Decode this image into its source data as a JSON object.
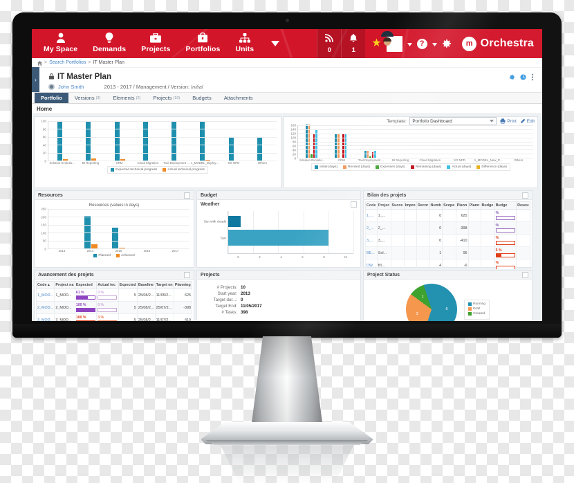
{
  "app": {
    "brand_name": "Orchestra",
    "brand_mark": "m",
    "nav": [
      {
        "label": "My Space",
        "icon": "user-icon"
      },
      {
        "label": "Demands",
        "icon": "lightbulb-icon"
      },
      {
        "label": "Projects",
        "icon": "briefcase-icon"
      },
      {
        "label": "Portfolios",
        "icon": "portfolio-icon"
      },
      {
        "label": "Units",
        "icon": "org-chart-icon"
      }
    ],
    "nav_caret": "caret-down-icon",
    "feed": {
      "icon": "rss-icon",
      "count": "0"
    },
    "alerts": {
      "icon": "bell-icon",
      "count": "1"
    },
    "star": "★",
    "help": "?",
    "settings_icon": "gear-icon"
  },
  "breadcrumb": {
    "home_icon": "home-icon",
    "sep": ">",
    "items": [
      "Search Portfolios",
      "IT Master Plan"
    ]
  },
  "header": {
    "side_toggle": "›",
    "lock_icon": "lock-icon",
    "title": "IT Master Plan",
    "user": "John Smith",
    "meta": "2013 - 2017 / Management / Version:",
    "meta_version": "Initial",
    "tools": [
      "gear-icon",
      "history-icon",
      "more-vert-icon"
    ]
  },
  "tabs": [
    {
      "label": "Portfolio",
      "count": "",
      "active": true
    },
    {
      "label": "Versions",
      "count": "(3)",
      "active": false
    },
    {
      "label": "Elements",
      "count": "(2)",
      "active": false
    },
    {
      "label": "Projects",
      "count": "(10)",
      "active": false
    },
    {
      "label": "Budgets",
      "count": "",
      "active": false
    },
    {
      "label": "Attachments",
      "count": "",
      "active": false
    }
  ],
  "subtitle": "Home",
  "template_bar": {
    "label": "Template:",
    "selected": "Portfolio Dashboard",
    "caret": "caret-down-icon",
    "print": "Print",
    "edit": "Edit"
  },
  "panels": {
    "progress_title": "",
    "resources_title": "Resources",
    "budget_title": "Budget",
    "weather_title": "Weather",
    "bilan_title": "Bilan des projets",
    "status_title": "Project Status",
    "avancement_title": "Avancement des projets",
    "projects_title": "Projects"
  },
  "colors": {
    "brand_red": "#d3152a",
    "teal": "#1f8fae",
    "orange": "#f08a24",
    "green": "#3aa02a",
    "dark_red": "#c00d18",
    "light_blue": "#3cc0e8",
    "yellow": "#e8b019",
    "nav_blue": "#3c5a78",
    "link": "#4a86c8"
  },
  "chart_data": [
    {
      "type": "bar",
      "id": "technical-progress",
      "title": "",
      "categories": [
        "Solution Evolutio...",
        "BI Reporting",
        "CRM",
        "Cloud Migration",
        "Tool Deployment ...",
        "1_MODEL_Deploymen...",
        "SG NPD",
        "Others"
      ],
      "series": [
        {
          "name": "Expected technical progress",
          "color": "#1f8fae",
          "values": [
            100,
            100,
            100,
            100,
            100,
            100,
            60,
            59
          ]
        },
        {
          "name": "Actual technical progress",
          "color": "#f08a24",
          "values": [
            4,
            6,
            4,
            0,
            0,
            2,
            0,
            0
          ]
        }
      ],
      "yticks": [
        "100",
        "80",
        "60",
        "40",
        "20",
        "0"
      ],
      "ylim": [
        0,
        100
      ],
      "legend_position": "bottom",
      "grid": true
    },
    {
      "type": "bar",
      "id": "portfolio-days",
      "title": "",
      "categories": [
        "Solution Evolutio...",
        "CRM",
        "Tool Deployment ...",
        "BI Reporting",
        "Cloud Migration",
        "SG NPD",
        "1_MODEL_New_Produ...",
        "Others"
      ],
      "series": [
        {
          "name": "Initial (days)",
          "color": "#1f8fae",
          "values": [
            165,
            120,
            35,
            0,
            0,
            0,
            0,
            0
          ]
        },
        {
          "name": "Revised (days)",
          "color": "#f0995a",
          "values": [
            165,
            120,
            35,
            0,
            0,
            0,
            0,
            0
          ]
        },
        {
          "name": "Expenses (days)",
          "color": "#3aa02a",
          "values": [
            22,
            0,
            6,
            0,
            0,
            0,
            0,
            0
          ]
        },
        {
          "name": "Remaining (days)",
          "color": "#c00d18",
          "values": [
            115,
            120,
            26,
            0,
            0,
            0,
            0,
            0
          ]
        },
        {
          "name": "Actual (days)",
          "color": "#3cc0e8",
          "values": [
            140,
            120,
            35,
            0,
            0,
            0,
            0,
            0
          ]
        },
        {
          "name": "Difference (days)",
          "color": "#e8b019",
          "values": [
            0,
            0,
            0,
            0,
            0,
            0,
            0,
            0
          ]
        }
      ],
      "yticks": [
        "160",
        "140",
        "120",
        "100",
        "80",
        "60",
        "40",
        "20",
        "0"
      ],
      "ylim": [
        0,
        160
      ],
      "legend_position": "bottom",
      "grid": true
    },
    {
      "type": "bar",
      "id": "resources",
      "title": "Resources (values in days)",
      "categories": [
        "2013",
        "2014",
        "2015",
        "2016",
        "2017"
      ],
      "series": [
        {
          "name": "Planned",
          "color": "#1f8fae",
          "values": [
            0,
            205,
            130,
            0,
            0
          ]
        },
        {
          "name": "Achieved",
          "color": "#f08a24",
          "values": [
            0,
            28,
            3,
            0,
            0
          ]
        }
      ],
      "yticks": [
        "250",
        "200",
        "150",
        "100",
        "50",
        "0"
      ],
      "ylim": [
        0,
        250
      ],
      "legend_position": "bottom",
      "grid": true
    },
    {
      "type": "bar",
      "id": "weather",
      "orientation": "horizontal",
      "title": "",
      "categories": [
        "Sun with clouds",
        "Sun"
      ],
      "series": [
        {
          "name": "Weather",
          "colors": [
            "#1079a0",
            "#3aa3c4"
          ],
          "values": [
            1,
            8
          ]
        }
      ],
      "xticks": [
        "0",
        "2",
        "4",
        "6",
        "8",
        "10"
      ],
      "xlim": [
        0,
        10
      ],
      "grid": true
    },
    {
      "type": "pie",
      "id": "project-status",
      "title": "Project Status",
      "labels": [
        "Running",
        "Draft",
        "Created"
      ],
      "values": [
        6,
        3,
        1
      ],
      "display_labels": [
        "6",
        "3",
        "1"
      ],
      "colors": [
        "#1f8fae",
        "#f6954a",
        "#3aa02a"
      ],
      "legend_position": "right"
    }
  ],
  "bilan_table": {
    "columns": [
      "Code",
      "Projec",
      "Succe",
      "Impro",
      "Recor",
      "Numb",
      "Scope",
      "Plann",
      "Plann",
      "Budge",
      "Budge",
      "Resou"
    ],
    "rows": [
      {
        "code": "1_...",
        "project": "1_...",
        "numb": "0",
        "plann": "625",
        "pct": "%",
        "bar": 0,
        "bar_color": "#9a6fc0",
        "pct_color": "#7a4fb0"
      },
      {
        "code": "2_...",
        "project": "2_...",
        "numb": "0",
        "plann": "-398",
        "pct": "%",
        "bar": 0,
        "bar_color": "#9a6fc0",
        "pct_color": "#7a4fb0"
      },
      {
        "code": "3_...",
        "project": "3_...",
        "numb": "0",
        "plann": "-410",
        "pct": "%",
        "bar": 0,
        "bar_color": "#e03a14",
        "pct_color": "#e03a14"
      },
      {
        "code": "BE...",
        "project": "Sol...",
        "numb": "1",
        "plann": "95",
        "pct": "5 %",
        "bar": 30,
        "bar_color": "#e03a14",
        "pct_color": "#e03a14"
      },
      {
        "code": "DW...",
        "project": "BI...",
        "numb": "4",
        "plann": "-6",
        "pct": "%",
        "bar": 0,
        "bar_color": "#e03a14",
        "pct_color": "#e03a14"
      }
    ]
  },
  "avancement_table": {
    "columns": [
      "Code",
      "Project na",
      "Expected",
      "Actual tec",
      "Expected",
      "Baseline",
      "Target en",
      "Planning"
    ],
    "sort_icon": "sort-asc-icon",
    "rows": [
      {
        "code": "1_MOD...",
        "name": "1_MOD...",
        "expected": "61 %",
        "expected_pct": 61,
        "expected_color": "#8e44c0",
        "actual": "0 %",
        "actual_pct": 0,
        "actual_color": "#c9a8d8",
        "expected2": "5",
        "baseline": "25/08/2...",
        "target": "11/05/2...",
        "planning": "625"
      },
      {
        "code": "2_MOD...",
        "name": "2_MOD...",
        "expected": "100 %",
        "expected_pct": 100,
        "expected_color": "#8e44c0",
        "actual": "0 %",
        "actual_pct": 0,
        "actual_color": "#c9a8d8",
        "expected2": "5",
        "baseline": "25/08/2...",
        "target": "25/07/2...",
        "planning": "-398"
      },
      {
        "code": "3_MOD...",
        "name": "3_MOD...",
        "expected": "100 %",
        "expected_pct": 100,
        "expected_color": "#e03a14",
        "actual": "3 %",
        "actual_pct": 3,
        "actual_color": "#e8714a",
        "expected2": "5",
        "baseline": "25/08/2...",
        "target": "11/07/2...",
        "planning": "-410"
      }
    ]
  },
  "projects_info": [
    {
      "key": "# Projects:",
      "value": "10"
    },
    {
      "key": "Start year:",
      "value": "2013"
    },
    {
      "key": "Target dur...:",
      "value": "0"
    },
    {
      "key": "Target End:",
      "value": "11/05/2017"
    },
    {
      "key": "# Tasks:",
      "value": "398"
    }
  ]
}
